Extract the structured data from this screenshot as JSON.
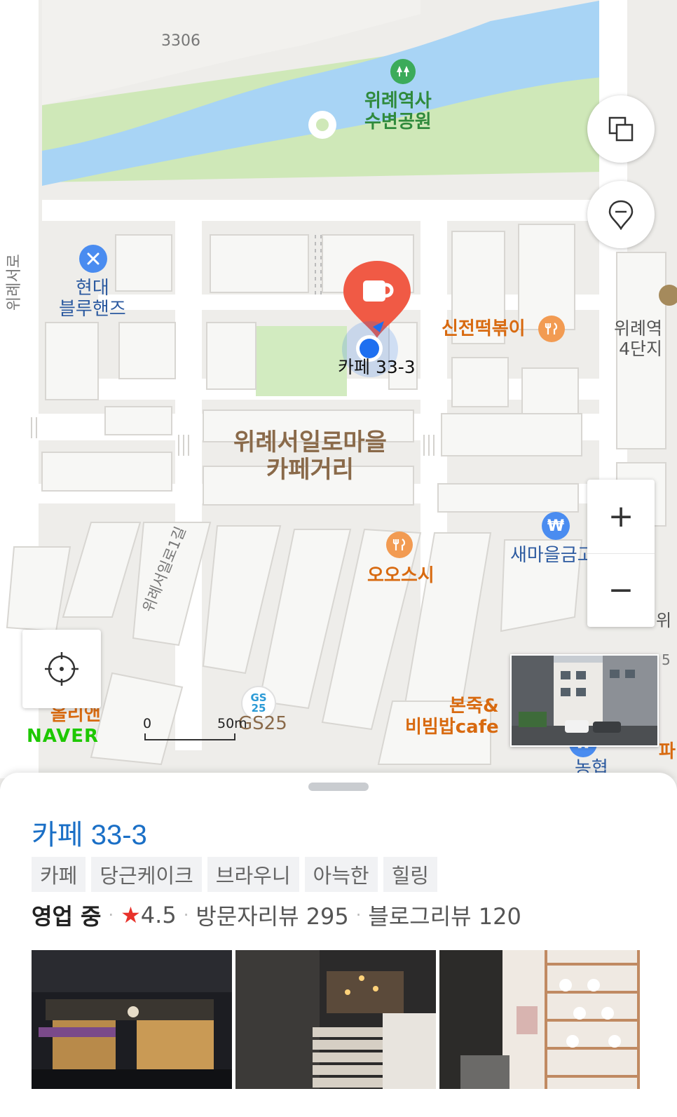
{
  "map": {
    "labels": {
      "road_3306": "3306",
      "park": "위례역사\n수변공원",
      "road_left": "위례서로",
      "hyundai": "현대\n블루핸즈",
      "selected_place": "카페 33-3",
      "sinjeon": "신전떡볶이",
      "apt_right": "위례역\n4단지",
      "district": "위례서일로마을\n카페거리",
      "street_1gil": "위례서일로1길",
      "oosushi": "오오스시",
      "saemaul": "새마을금고",
      "olien": "올리앤",
      "gs25": "GS25",
      "bonjuk": "본죽&\n비빔밥cafe",
      "edge_wi": "위",
      "edge_5": "5",
      "edge_pa": "파",
      "edge_nong": "농협"
    },
    "gs25_logo": "GS\n25",
    "scale": {
      "start": "0",
      "end": "50m"
    },
    "brand": "NAVER",
    "controls": {
      "layers_icon": "layers-icon",
      "location_pin_icon": "location-pin-icon",
      "zoom_in": "+",
      "zoom_out": "−",
      "my_location_icon": "crosshair-icon"
    },
    "colors": {
      "water": "#a8d4f5",
      "park": "#cfe8b8",
      "selected_marker": "#f05a45",
      "current_location": "#1e6ff0"
    }
  },
  "place": {
    "name": "카페 33-3",
    "tags": [
      "카페",
      "당근케이크",
      "브라우니",
      "아늑한",
      "힐링"
    ],
    "status": "영업 중",
    "rating": "4.5",
    "visitor_reviews": "방문자리뷰 295",
    "blog_reviews": "블로그리뷰 120"
  }
}
